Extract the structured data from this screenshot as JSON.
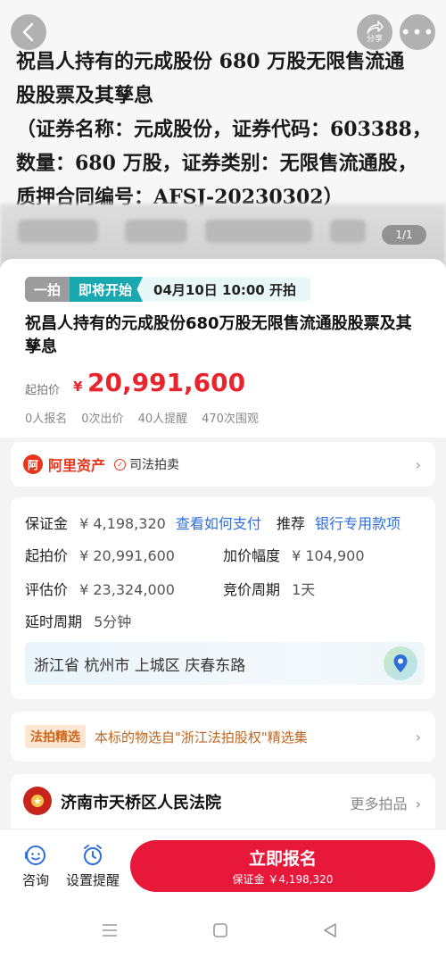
{
  "hero": {
    "text": "祝昌人持有的元成股份 680 万股无限售流通\n股股票及其孳息\n（证券名称：元成股份，证券代码：603388，\n数量：680 万股，证券类别：无限售流通股，\n质押合同编号：AFSJ-20230302）",
    "share_label": "分享",
    "counter": "1/1"
  },
  "auction": {
    "badge_type": "一拍",
    "badge_status": "即将开始",
    "start_time": "04月10日 10:00 开拍",
    "title": "祝昌人持有的元成股份680万股无限售流通股股票及其孳息",
    "price_label": "起拍价",
    "currency": "¥",
    "price": "20,991,600",
    "stats": [
      "0人报名",
      "0次出价",
      "40人提醒",
      "470次围观"
    ]
  },
  "merchant": {
    "logo_text": "阿",
    "name": "阿里资产",
    "tag": "司法拍卖"
  },
  "info": {
    "deposit_label": "保证金",
    "deposit_value": "¥ 4,198,320",
    "deposit_link": "查看如何支付",
    "recommend_label": "推荐",
    "recommend_link": "银行专用款项",
    "start_price_label": "起拍价",
    "start_price_value": "¥ 20,991,600",
    "increment_label": "加价幅度",
    "increment_value": "¥ 104,900",
    "eval_label": "评估价",
    "eval_value": "¥ 23,324,000",
    "cycle_label": "竞价周期",
    "cycle_value": "1天",
    "delay_label": "延时周期",
    "delay_value": "5分钟",
    "address": "浙江省 杭州市 上城区 庆春东路"
  },
  "pick": {
    "tag": "法拍精选",
    "text": "本标的物选自\"浙江法拍股权\"精选集"
  },
  "court": {
    "name": "济南市天桥区人民法院",
    "more": "更多拍品"
  },
  "bottom": {
    "consult": "咨询",
    "remind": "设置提醒",
    "cta_main": "立即报名",
    "cta_sub": "保证金 ￥4,198,320"
  },
  "colors": {
    "accent": "#e8183a",
    "price": "#e8252c",
    "teal": "#19a7b0",
    "link": "#2f6fd8"
  }
}
